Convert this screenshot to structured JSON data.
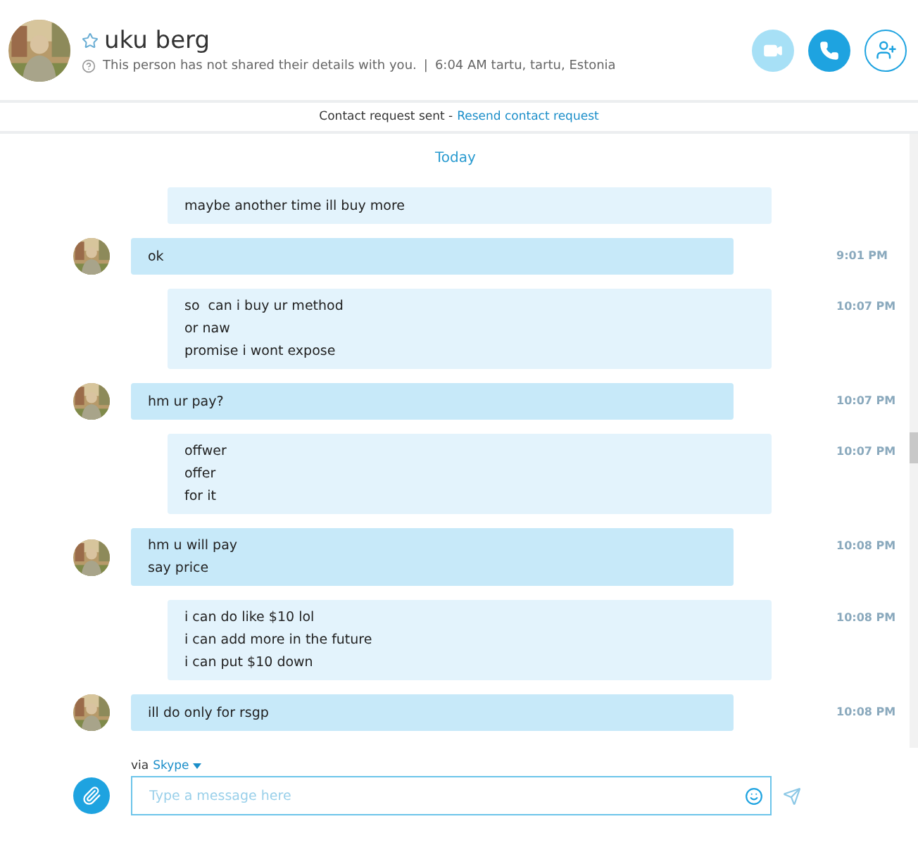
{
  "contact": {
    "name": "uku berg",
    "favorite": false,
    "details": "This person has not shared their details with you.",
    "separator": "|",
    "local_time": "6:04 AM tartu, tartu, Estonia"
  },
  "actions": [
    {
      "kind": "video",
      "disabled": true
    },
    {
      "kind": "call",
      "disabled": false
    },
    {
      "kind": "add-contact",
      "disabled": false
    }
  ],
  "request_bar": {
    "text": "Contact request sent -",
    "link": "Resend contact request"
  },
  "day_label": "Today",
  "messages": [
    {
      "kind": "outgoing",
      "lines": [
        "maybe another time ill buy more"
      ]
    },
    {
      "kind": "incoming",
      "lines": [
        "ok"
      ],
      "time": "9:01 PM"
    },
    {
      "kind": "outgoing",
      "lines": [
        "so  can i buy ur method",
        "or naw",
        "promise i wont expose"
      ],
      "time": "10:07 PM"
    },
    {
      "kind": "incoming",
      "lines": [
        "hm ur pay?"
      ],
      "time": "10:07 PM"
    },
    {
      "kind": "outgoing",
      "lines": [
        "offwer",
        "offer",
        "for it"
      ],
      "time": "10:07 PM"
    },
    {
      "kind": "incoming",
      "lines": [
        "hm u will pay",
        "say price"
      ],
      "time": "10:08 PM"
    },
    {
      "kind": "outgoing",
      "lines": [
        "i can do like $10 lol",
        "i can add more in the future",
        "i can put $10 down"
      ],
      "time": "10:08 PM"
    },
    {
      "kind": "incoming",
      "lines": [
        "ill do only for rsgp"
      ],
      "time": "10:08 PM"
    }
  ],
  "composer": {
    "via": "via",
    "service": "Skype",
    "placeholder": "Type a message here"
  }
}
